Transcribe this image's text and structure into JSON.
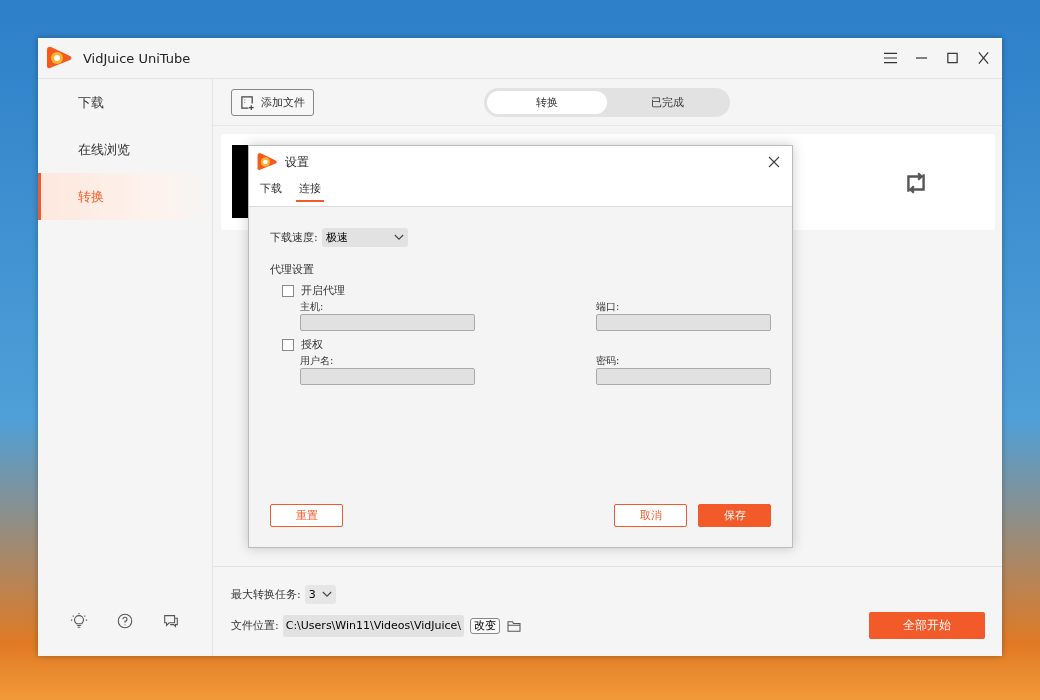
{
  "window": {
    "title": "VidJuice UniTube"
  },
  "sidebar": {
    "items": [
      {
        "label": "下载",
        "selected": false
      },
      {
        "label": "在线浏览",
        "selected": false
      },
      {
        "label": "转换",
        "selected": true
      }
    ]
  },
  "toolbar": {
    "add_file_button": "添加文件",
    "tabs": [
      {
        "label": "转换",
        "selected": true
      },
      {
        "label": "已完成",
        "selected": false
      }
    ]
  },
  "footer": {
    "max_tasks": {
      "label": "最大转换任务:",
      "value": "3"
    },
    "file_location": {
      "label": "文件位置:",
      "value": "C:\\Users\\Win11\\Videos\\VidJuice\\",
      "change_button": "改变"
    },
    "start_all_button": "全部开始"
  },
  "dialog": {
    "title": "设置",
    "tabs": [
      {
        "label": "下载",
        "selected": false
      },
      {
        "label": "连接",
        "selected": true
      }
    ],
    "speed": {
      "label": "下载速度:",
      "value": "极速"
    },
    "proxy": {
      "title": "代理设置",
      "options": [
        {
          "label": "开启代理",
          "checked": false,
          "fields": [
            {
              "label": "主机:",
              "disabled": true
            },
            {
              "label": "端口:",
              "disabled": true
            }
          ]
        },
        {
          "label": "授权",
          "checked": false,
          "fields": [
            {
              "label": "用户名:",
              "disabled": true
            },
            {
              "label": "密码:",
              "disabled": true
            }
          ]
        }
      ]
    },
    "buttons": [
      {
        "label": "重置",
        "kind": "outline"
      },
      {
        "label": "取消",
        "kind": "outline"
      },
      {
        "label": "保存",
        "kind": "primary"
      }
    ]
  }
}
